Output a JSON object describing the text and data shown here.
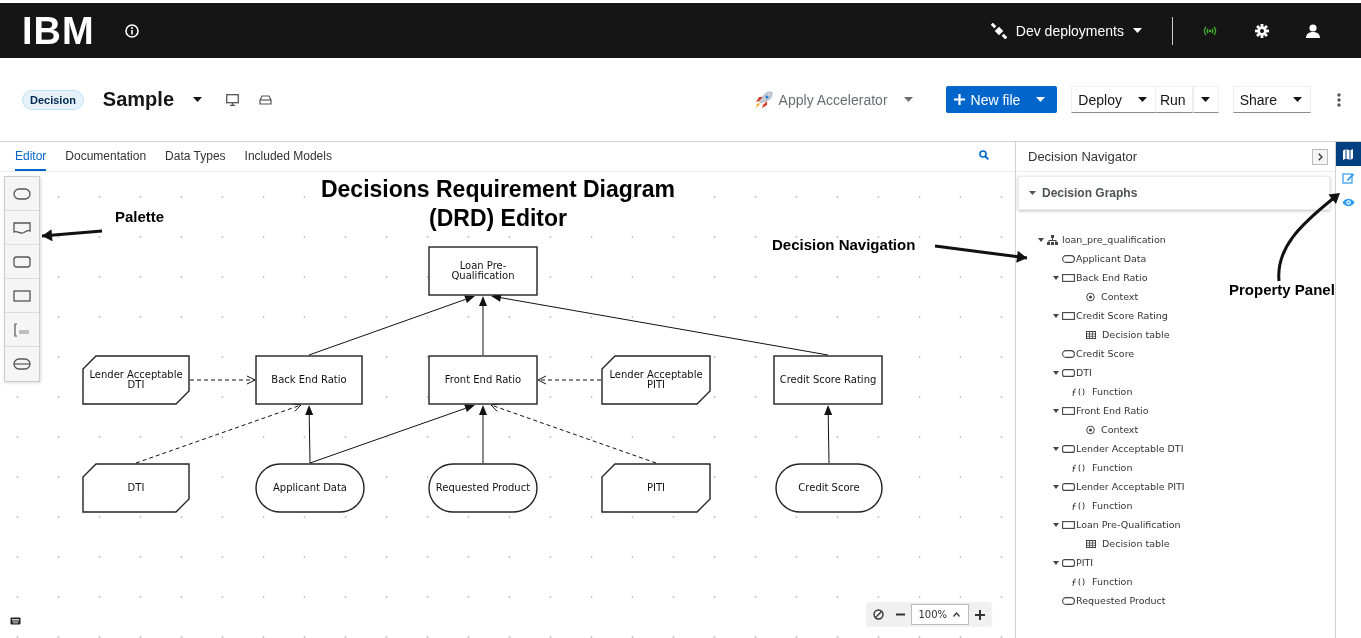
{
  "header": {
    "logo": "IBM",
    "deployments": "Dev deployments"
  },
  "toolbar": {
    "badge": "Decision",
    "title": "Sample",
    "accelerator": "Apply Accelerator",
    "buttons": [
      {
        "label": "New file",
        "kind": "primary"
      },
      {
        "label": "Deploy",
        "kind": "dropdown"
      },
      {
        "label": "Run",
        "kind": "split"
      },
      {
        "label": "Share",
        "kind": "dropdown"
      }
    ]
  },
  "tabs": [
    {
      "label": "Editor",
      "selected": true
    },
    {
      "label": "Documentation",
      "selected": false
    },
    {
      "label": "Data Types",
      "selected": false
    },
    {
      "label": "Included Models",
      "selected": false
    }
  ],
  "palette": [
    {
      "kind": "input_data"
    },
    {
      "kind": "knowledge_source"
    },
    {
      "kind": "bkm"
    },
    {
      "kind": "decision"
    },
    {
      "kind": "text_annotation"
    },
    {
      "kind": "decision_service"
    }
  ],
  "diagram": {
    "nodes": [
      {
        "label": "Loan Pre-Qualification",
        "kind": "decision"
      },
      {
        "label": "Lender Acceptable DTI",
        "kind": "bkm"
      },
      {
        "label": "Back End Ratio",
        "kind": "decision"
      },
      {
        "label": "Front End Ratio",
        "kind": "decision"
      },
      {
        "label": "Lender Acceptable PITI",
        "kind": "bkm"
      },
      {
        "label": "Credit Score Rating",
        "kind": "decision"
      },
      {
        "label": "DTI",
        "kind": "bkm"
      },
      {
        "label": "Applicant Data",
        "kind": "input_data"
      },
      {
        "label": "Requested Product",
        "kind": "input_data"
      },
      {
        "label": "PITI",
        "kind": "bkm"
      },
      {
        "label": "Credit Score",
        "kind": "input_data"
      }
    ],
    "edges": [
      {
        "kind": "information"
      },
      {
        "kind": "information"
      },
      {
        "kind": "information"
      },
      {
        "kind": "knowledge"
      },
      {
        "kind": "knowledge"
      },
      {
        "kind": "knowledge"
      },
      {
        "kind": "information"
      },
      {
        "kind": "information"
      },
      {
        "kind": "information"
      },
      {
        "kind": "knowledge"
      },
      {
        "kind": "information"
      }
    ]
  },
  "zoom": {
    "value": "100%"
  },
  "navigator": {
    "title": "Decision Navigator",
    "section": {
      "label": "Decision Graphs",
      "expanded": true
    },
    "tree": [
      {
        "label": "loan_pre_qualification",
        "kind": "graph",
        "expanded": true,
        "children": [
          {
            "label": "Applicant Data",
            "kind": "input_data"
          },
          {
            "label": "Back End Ratio",
            "kind": "decision",
            "expanded": true,
            "children": [
              {
                "label": "Context",
                "kind": "context"
              }
            ]
          },
          {
            "label": "Credit Score Rating",
            "kind": "decision",
            "expanded": true,
            "children": [
              {
                "label": "Decision table",
                "kind": "decision_table"
              }
            ]
          },
          {
            "label": "Credit Score",
            "kind": "input_data"
          },
          {
            "label": "DTI",
            "kind": "bkm",
            "expanded": true,
            "children": [
              {
                "label": "Function",
                "kind": "function"
              }
            ]
          },
          {
            "label": "Front End Ratio",
            "kind": "decision",
            "expanded": true,
            "children": [
              {
                "label": "Context",
                "kind": "context"
              }
            ]
          },
          {
            "label": "Lender Acceptable DTI",
            "kind": "bkm",
            "expanded": true,
            "children": [
              {
                "label": "Function",
                "kind": "function"
              }
            ]
          },
          {
            "label": "Lender Acceptable PITI",
            "kind": "bkm",
            "expanded": true,
            "children": [
              {
                "label": "Function",
                "kind": "function"
              }
            ]
          },
          {
            "label": "Loan Pre-Qualification",
            "kind": "decision",
            "expanded": true,
            "children": [
              {
                "label": "Decision table",
                "kind": "decision_table"
              }
            ]
          },
          {
            "label": "PITI",
            "kind": "bkm",
            "expanded": true,
            "children": [
              {
                "label": "Function",
                "kind": "function"
              }
            ]
          },
          {
            "label": "Requested Product",
            "kind": "input_data"
          }
        ]
      }
    ]
  },
  "side_panel": [
    {
      "kind": "navigator",
      "selected": true
    },
    {
      "kind": "properties",
      "selected": false
    },
    {
      "kind": "preview",
      "selected": false
    }
  ],
  "annotations": [
    {
      "text": "Palette",
      "kind": "callout"
    },
    {
      "text": "Decisions Requirement Diagram (DRD) Editor",
      "kind": "title"
    },
    {
      "text": "Decision Navigation",
      "kind": "callout"
    },
    {
      "text": "Property Panel",
      "kind": "callout"
    }
  ]
}
